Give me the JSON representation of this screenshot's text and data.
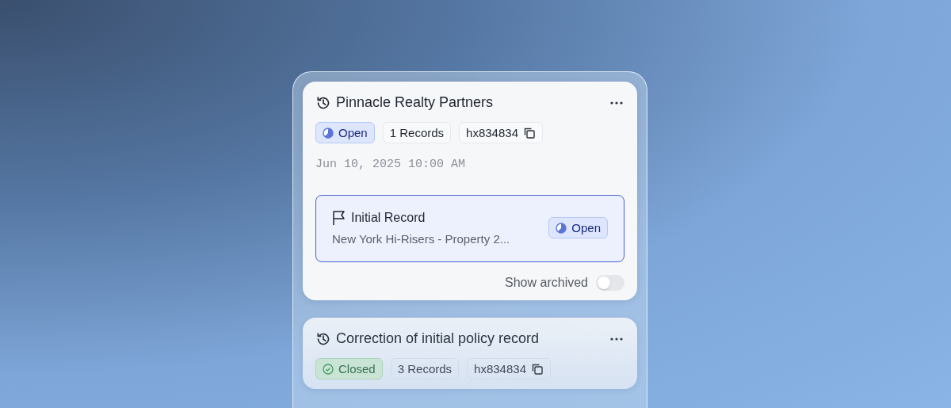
{
  "cards": [
    {
      "title": "Pinnacle Realty Partners",
      "status": {
        "kind": "open",
        "label": "Open"
      },
      "records": "1 Records",
      "id": "hx834834",
      "date": "Jun 10, 2025 10:00 AM",
      "record": {
        "title": "Initial Record",
        "subtitle": "New York Hi-Risers - Property 2...",
        "selected": true,
        "status": {
          "kind": "open",
          "label": "Open"
        }
      },
      "archive": {
        "label": "Show archived",
        "on": false
      }
    },
    {
      "title": "Correction of initial policy record",
      "status": {
        "kind": "closed",
        "label": "Closed"
      },
      "records": "3 Records",
      "id": "hx834834"
    }
  ]
}
